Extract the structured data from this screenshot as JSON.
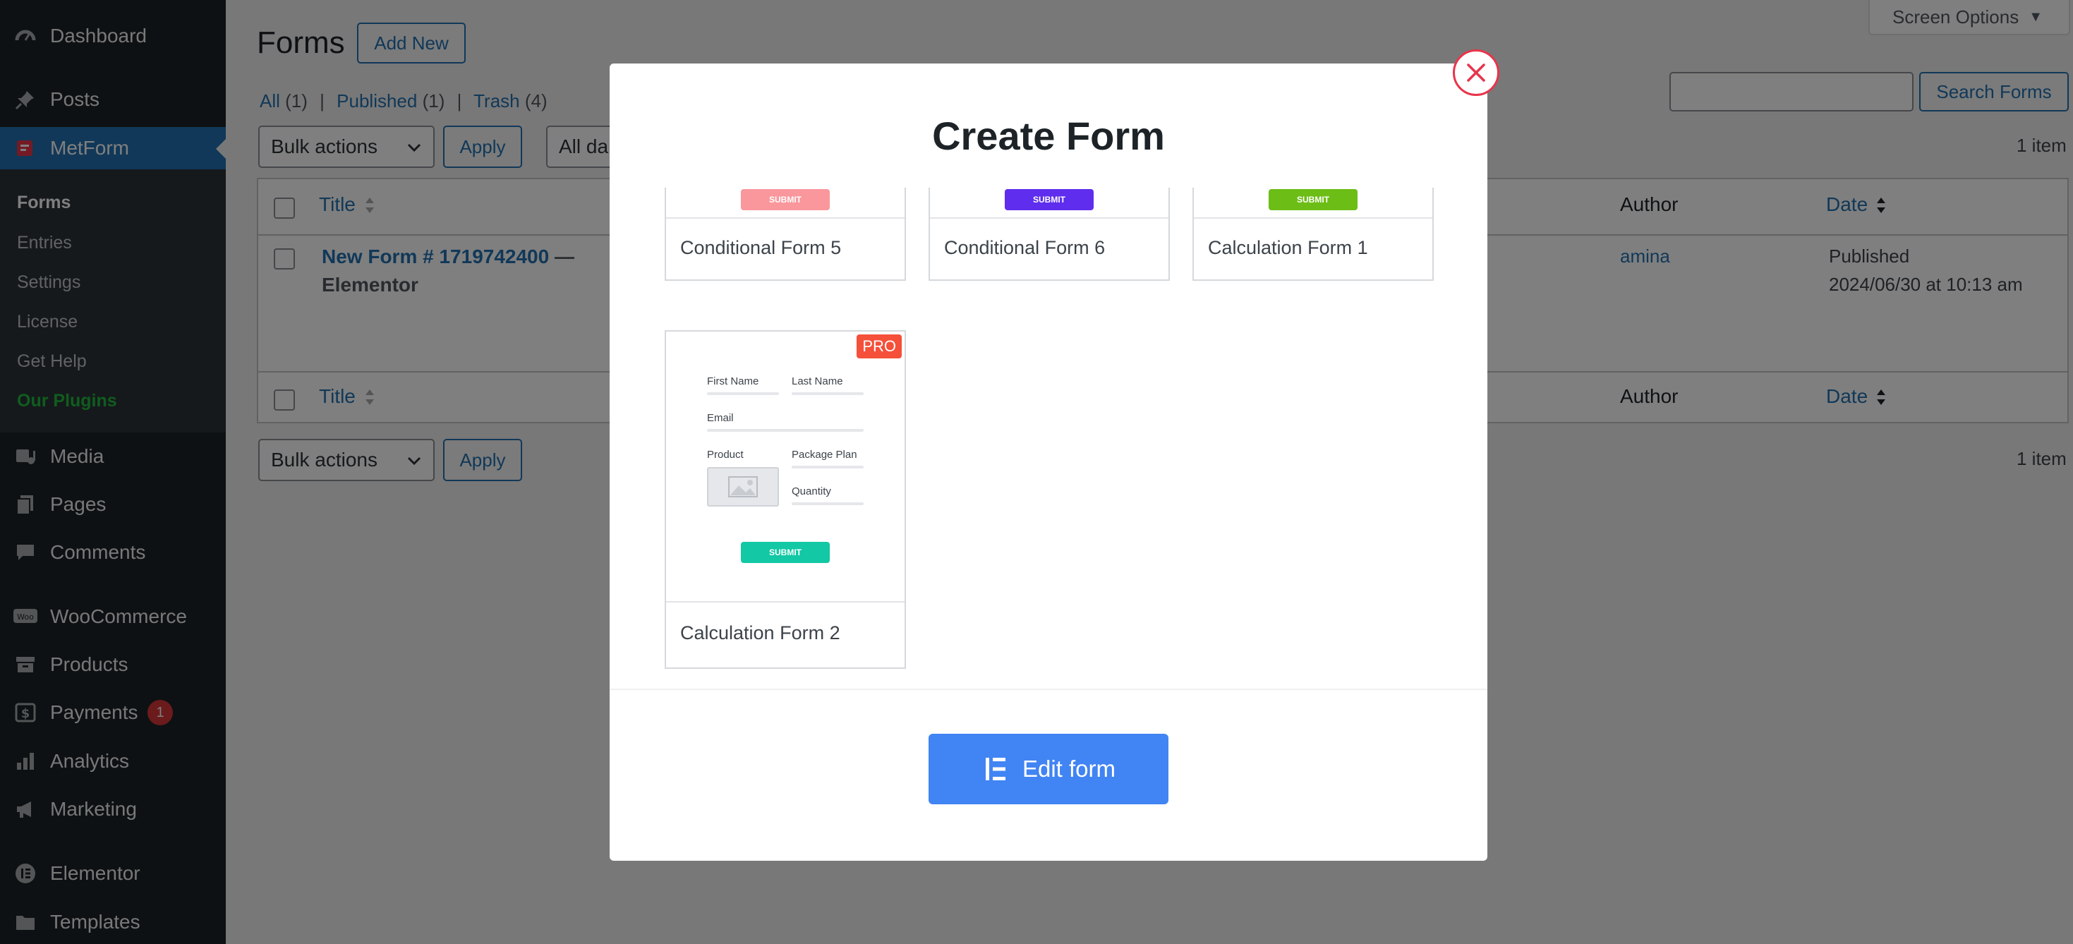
{
  "sidebar": {
    "items": [
      {
        "label": "Dashboard",
        "icon": "dashboard-icon"
      },
      {
        "label": "Posts",
        "icon": "pin-icon"
      },
      {
        "label": "MetForm",
        "icon": "metform-icon"
      },
      {
        "label": "Media",
        "icon": "media-icon"
      },
      {
        "label": "Pages",
        "icon": "pages-icon"
      },
      {
        "label": "Comments",
        "icon": "comment-icon"
      },
      {
        "label": "WooCommerce",
        "icon": "woo-icon"
      },
      {
        "label": "Products",
        "icon": "archive-icon"
      },
      {
        "label": "Payments",
        "icon": "dollar-icon",
        "badge": "1"
      },
      {
        "label": "Analytics",
        "icon": "bar-chart-icon"
      },
      {
        "label": "Marketing",
        "icon": "megaphone-icon"
      },
      {
        "label": "Elementor",
        "icon": "elementor-icon"
      },
      {
        "label": "Templates",
        "icon": "folder-icon"
      }
    ],
    "submenu": [
      "Forms",
      "Entries",
      "Settings",
      "License",
      "Get Help",
      "Our Plugins"
    ]
  },
  "header": {
    "title": "Forms",
    "add_new": "Add New",
    "screen_options": "Screen Options"
  },
  "filters": {
    "all": "All",
    "all_count": "(1)",
    "published": "Published",
    "published_count": "(1)",
    "trash": "Trash",
    "trash_count": "(4)",
    "sep": "|"
  },
  "search": {
    "value": "",
    "button": "Search Forms"
  },
  "bulk": {
    "label": "Bulk actions",
    "apply": "Apply",
    "dates": "All da"
  },
  "item_count": "1 item",
  "table": {
    "col_title": "Title",
    "col_author": "Author",
    "col_date": "Date",
    "row": {
      "title": "New Form # 1719742400",
      "suffix": "— Elementor",
      "author": "amina",
      "status": "Published",
      "date": "2024/06/30 at 10:13 am"
    }
  },
  "modal": {
    "title": "Create Form",
    "edit_button": "Edit form",
    "submit_text": "SUBMIT",
    "pro_badge": "PRO",
    "templates": [
      {
        "name": "Conditional Form 5",
        "submit_color": "#f9979c"
      },
      {
        "name": "Conditional Form 6",
        "submit_color": "#5f2ded"
      },
      {
        "name": "Calculation Form 1",
        "submit_color": "#6cbd16"
      },
      {
        "name": "Calculation Form 2",
        "submit_color": "#12c8a5"
      }
    ],
    "preview_fields": {
      "first_name": "First Name",
      "last_name": "Last Name",
      "email": "Email",
      "product": "Product",
      "package_plan": "Package Plan",
      "quantity": "Quantity"
    }
  },
  "colors": {
    "wp_blue": "#2271b1",
    "sidebar": "#1d2327",
    "close_red": "#e8344b",
    "edit_blue": "#4184f3"
  }
}
